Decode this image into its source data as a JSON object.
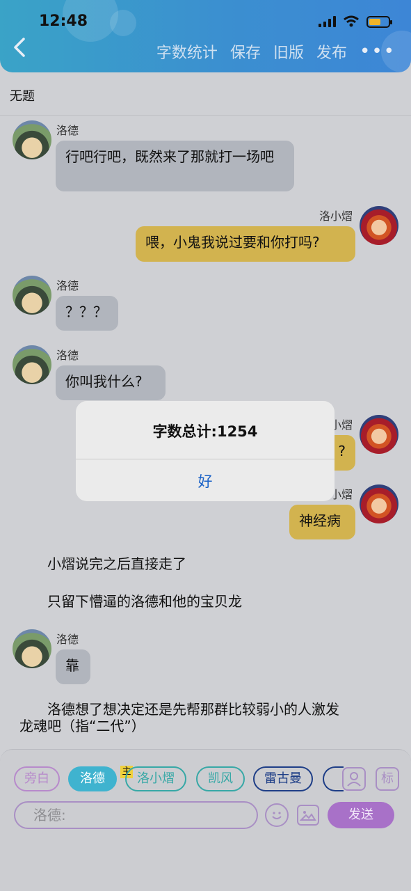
{
  "status": {
    "time": "12:48"
  },
  "header": {
    "back_icon": "chevron-left-icon",
    "nav": [
      "字数统计",
      "保存",
      "旧版",
      "发布"
    ],
    "more": "•••"
  },
  "doc": {
    "title": "无题"
  },
  "messages": [
    {
      "name": "洛德",
      "text": "行吧行吧，既然来了那就打一场吧"
    },
    {
      "name": "洛小熠",
      "text": "喂，小鬼我说过要和你打吗?"
    },
    {
      "name": "洛德",
      "text": "？？？"
    },
    {
      "name": "洛德",
      "text": "你叫我什么?"
    },
    {
      "name": "小熠",
      "text": "?"
    },
    {
      "name": "小熠",
      "text": "神经病"
    },
    {
      "name": "洛德",
      "text": "靠"
    }
  ],
  "narrations": [
    "小熠说完之后直接走了",
    "只留下懵逼的洛德和他的宝贝龙",
    "洛德想了想决定还是先帮那群比较弱小的人激发",
    "龙魂吧（指“二代”）"
  ],
  "dialog": {
    "title": "字数总计:1254",
    "ok": "好"
  },
  "roles": {
    "narrator": "旁白",
    "items": [
      "洛德",
      "洛小熠",
      "凯风",
      "雷古曼"
    ],
    "main_tag": "主"
  },
  "tools": {
    "person_icon": "person-icon",
    "mark_label": "标"
  },
  "input": {
    "placeholder": "洛德:"
  },
  "send": {
    "label": "发送"
  }
}
